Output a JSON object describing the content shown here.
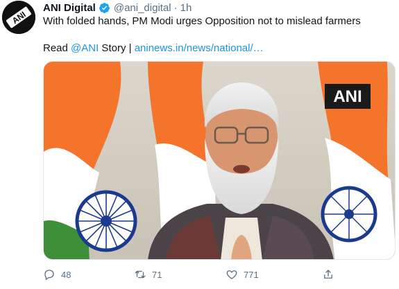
{
  "tweet": {
    "author_name": "ANI Digital",
    "handle": "@ani_digital",
    "separator": "·",
    "time": "1h",
    "text": "With folded hands, PM Modi urges Opposition not to mislead farmers",
    "read_prefix": "Read ",
    "mention": "@ANI",
    "story_text": " Story | ",
    "link": "aninews.in/news/national/…"
  },
  "media": {
    "watermark": "ANI"
  },
  "avatar": {
    "logo_text": "ANI"
  },
  "actions": {
    "replies": "48",
    "retweets": "71",
    "likes": "771"
  },
  "colors": {
    "accent": "#1b95e0",
    "muted": "#5b7083",
    "saffron": "#f4742b",
    "green": "#3e8f3a",
    "chakra": "#1a3a8f"
  },
  "icons": [
    "verified-badge-icon",
    "reply-icon",
    "retweet-icon",
    "like-icon",
    "share-icon"
  ]
}
